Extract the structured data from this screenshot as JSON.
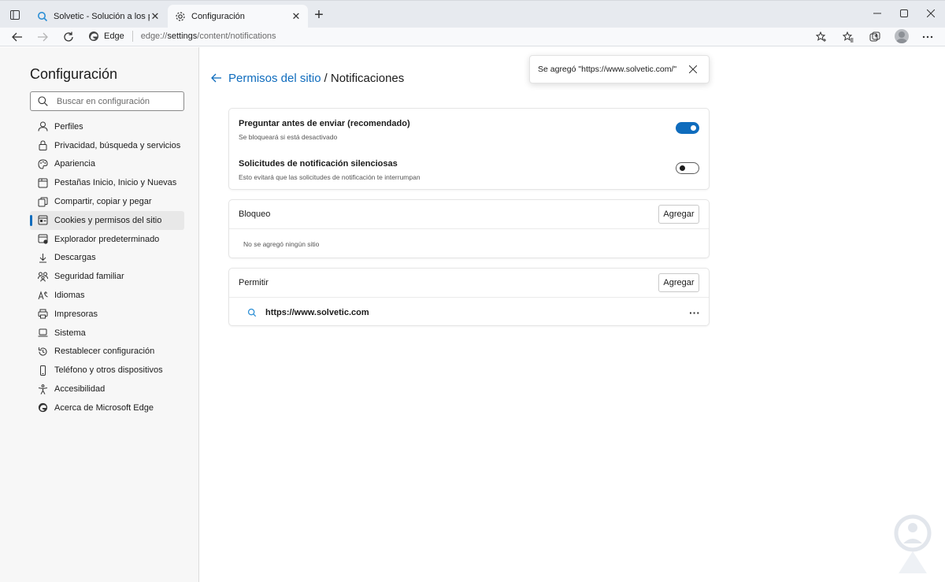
{
  "tabs": [
    {
      "title": "Solvetic - Solución a los problem",
      "icon": "solvetic-favicon",
      "active": false
    },
    {
      "title": "Configuración",
      "icon": "gear-icon",
      "active": true
    }
  ],
  "toolbar": {
    "brand": "Edge",
    "url_prefix": "edge://",
    "url_main": "settings",
    "url_rest": "/content/notifications"
  },
  "sidebar": {
    "title": "Configuración",
    "search_placeholder": "Buscar en configuración",
    "items": [
      {
        "label": "Perfiles",
        "icon": "profile-icon"
      },
      {
        "label": "Privacidad, búsqueda y servicios",
        "icon": "lock-icon"
      },
      {
        "label": "Apariencia",
        "icon": "appearance-icon"
      },
      {
        "label": "Pestañas Inicio, Inicio y Nuevas",
        "icon": "tabs-icon"
      },
      {
        "label": "Compartir, copiar y pegar",
        "icon": "share-icon"
      },
      {
        "label": "Cookies y permisos del sitio",
        "icon": "cookies-icon",
        "selected": true
      },
      {
        "label": "Explorador predeterminado",
        "icon": "browser-icon"
      },
      {
        "label": "Descargas",
        "icon": "download-icon"
      },
      {
        "label": "Seguridad familiar",
        "icon": "family-icon"
      },
      {
        "label": "Idiomas",
        "icon": "language-icon"
      },
      {
        "label": "Impresoras",
        "icon": "printer-icon"
      },
      {
        "label": "Sistema",
        "icon": "laptop-icon"
      },
      {
        "label": "Restablecer configuración",
        "icon": "reset-icon"
      },
      {
        "label": "Teléfono y otros dispositivos",
        "icon": "phone-icon"
      },
      {
        "label": "Accesibilidad",
        "icon": "accessibility-icon"
      },
      {
        "label": "Acerca de Microsoft Edge",
        "icon": "edge-icon"
      }
    ]
  },
  "main": {
    "breadcrumb_link": "Permisos del sitio",
    "breadcrumb_current": "/ Notificaciones",
    "toast": "Se agregó \"https://www.solvetic.com/\"",
    "settings": [
      {
        "title": "Preguntar antes de enviar (recomendado)",
        "desc": "Se bloqueará si está desactivado",
        "enabled": true
      },
      {
        "title": "Solicitudes de notificación silenciosas",
        "desc": "Esto evitará que las solicitudes de notificación te interrumpan",
        "enabled": false
      }
    ],
    "block": {
      "title": "Bloqueo",
      "add_label": "Agregar",
      "empty": "No se agregó ningún sitio"
    },
    "allow": {
      "title": "Permitir",
      "add_label": "Agregar",
      "sites": [
        "https://www.solvetic.com"
      ],
      "more_label": "···"
    }
  },
  "colors": {
    "accent": "#0f6cbd",
    "sidebar_bg": "#f7f7f7",
    "tabstrip_bg": "#e7eaef"
  }
}
